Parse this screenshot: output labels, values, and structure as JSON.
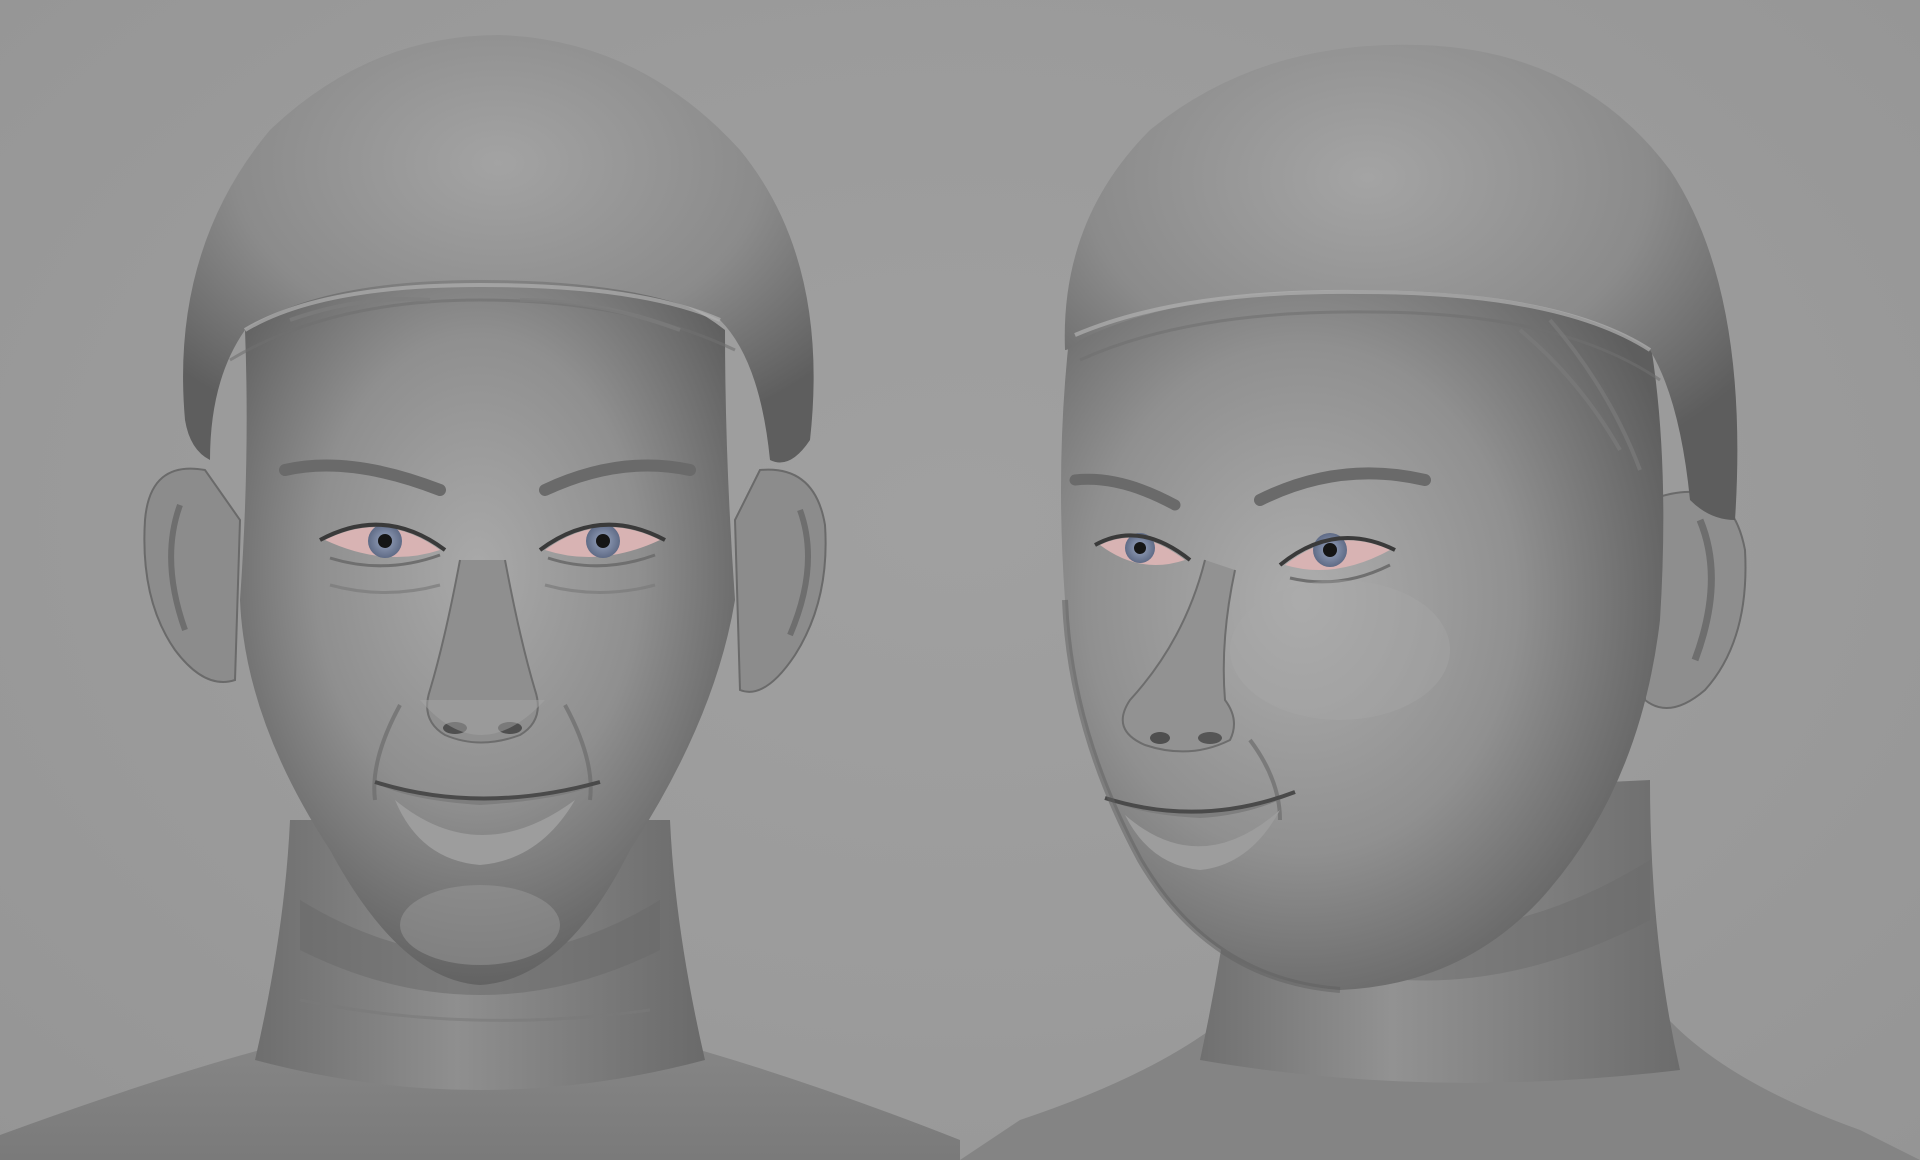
{
  "scene": {
    "background_color": "#9a9a9a",
    "clay_color": "#8e8e8e",
    "cap_color": "#8a8a8a",
    "iris_color": "#7d8aa6",
    "sclera_tint": "#d9b0b0"
  },
  "views": [
    {
      "name": "front-view",
      "icon": "sculpted-head-front"
    },
    {
      "name": "three-quarter-view",
      "icon": "sculpted-head-three-quarter"
    }
  ]
}
